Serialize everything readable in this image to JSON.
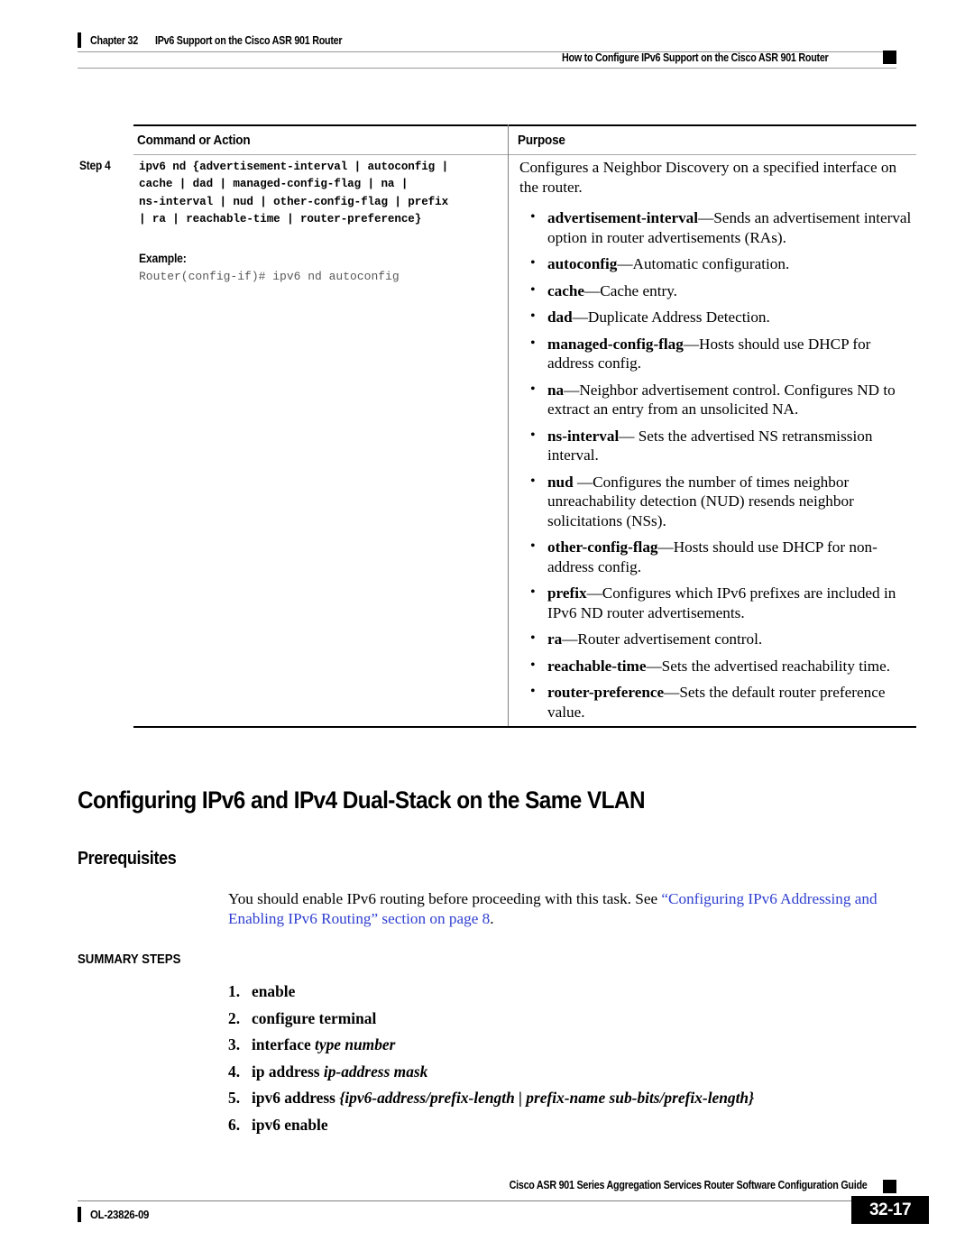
{
  "header": {
    "chapter": "Chapter 32",
    "chapter_title": "IPv6 Support on the Cisco ASR 901 Router",
    "section_title": "How to Configure IPv6 Support on the Cisco ASR 901 Router"
  },
  "table": {
    "col_command": "Command or Action",
    "col_purpose": "Purpose",
    "step_label": "Step 4",
    "command_syntax_lines": [
      "ipv6 nd {advertisement-interval | autoconfig |",
      "cache | dad | managed-config-flag | na |",
      "ns-interval | nud | other-config-flag | prefix",
      "| ra | reachable-time | router-preference}"
    ],
    "example_label": "Example:",
    "example_code": "Router(config-if)# ipv6 nd autoconfig",
    "purpose_intro": "Configures a Neighbor Discovery on a specified interface on the router.",
    "purpose_bullets": [
      {
        "term": "advertisement-interval",
        "sep": "—",
        "text": "Sends an advertisement interval option in router advertisements (RAs)."
      },
      {
        "term": "autoconfig",
        "sep": "—",
        "text": "Automatic configuration."
      },
      {
        "term": "cache",
        "sep": "—",
        "text": "Cache entry."
      },
      {
        "term": "dad",
        "sep": "—",
        "text": "Duplicate Address Detection."
      },
      {
        "term": "managed-config-flag",
        "sep": "—",
        "text": "Hosts should use DHCP for address config."
      },
      {
        "term": "na",
        "sep": "—",
        "text": "Neighbor advertisement control. Configures ND to extract an entry from an unsolicited NA."
      },
      {
        "term": "ns-interval",
        "sep": "— ",
        "text": "Sets the advertised NS retransmission interval."
      },
      {
        "term": "nud ",
        "sep": "—",
        "text": "Configures the number of times neighbor unreachability detection (NUD) resends neighbor solicitations (NSs)."
      },
      {
        "term": "other-config-flag",
        "sep": "—",
        "text": "Hosts should use DHCP for non-address config."
      },
      {
        "term": "prefix",
        "sep": "—",
        "text": "Configures which IPv6 prefixes are included in IPv6 ND router advertisements."
      },
      {
        "term": "ra",
        "sep": "—",
        "text": "Router advertisement control."
      },
      {
        "term": "reachable-time",
        "sep": "—",
        "text": "Sets the advertised reachability time."
      },
      {
        "term": "router-preference",
        "sep": "—",
        "text": "Sets the default router preference value."
      }
    ]
  },
  "body": {
    "heading1": "Configuring IPv6 and IPv4 Dual-Stack on the Same VLAN",
    "heading2": "Prerequisites",
    "prereq_plain": "You should enable IPv6 routing before proceeding with this task. See ",
    "prereq_link": "“Configuring IPv6 Addressing and Enabling IPv6 Routing” section on page 8",
    "prereq_end": ".",
    "link_color": "#2f3fd0",
    "heading3": "SUMMARY STEPS",
    "steps": [
      {
        "num": "1.",
        "bold": "enable",
        "italic": ""
      },
      {
        "num": "2.",
        "bold": "configure terminal",
        "italic": ""
      },
      {
        "num": "3.",
        "bold": "interface ",
        "italic": "type number"
      },
      {
        "num": "4.",
        "bold": "ip address ",
        "italic": "ip-address mask"
      },
      {
        "num": "5.",
        "bold": "ipv6 address ",
        "italic": "{ipv6-address/prefix-length | prefix-name sub-bits/prefix-length}"
      },
      {
        "num": "6.",
        "bold": "ipv6 enable",
        "italic": ""
      }
    ]
  },
  "footer": {
    "guide_title": "Cisco ASR 901 Series Aggregation Services Router Software Configuration Guide",
    "doc_id": "OL-23826-09",
    "page_number": "32-17"
  }
}
